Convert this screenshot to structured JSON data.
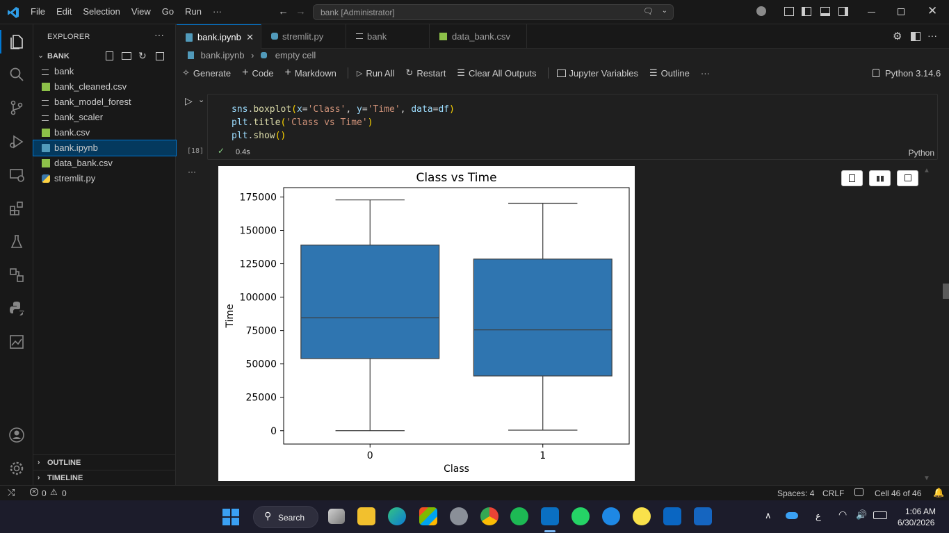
{
  "titlebar": {
    "menu": [
      "File",
      "Edit",
      "Selection",
      "View",
      "Go",
      "Run",
      "···"
    ],
    "search": "bank [Administrator]"
  },
  "sidebar": {
    "title": "EXPLORER",
    "folder": "BANK",
    "files": [
      {
        "name": "bank",
        "icon": "lines-icon"
      },
      {
        "name": "bank_cleaned.csv",
        "icon": "csv-icon"
      },
      {
        "name": "bank_model_forest",
        "icon": "lines-icon"
      },
      {
        "name": "bank_scaler",
        "icon": "lines-icon"
      },
      {
        "name": "bank.csv",
        "icon": "csv-icon"
      },
      {
        "name": "bank.ipynb",
        "icon": "notebook-icon"
      },
      {
        "name": "data_bank.csv",
        "icon": "csv-icon"
      },
      {
        "name": "stremlit.py",
        "icon": "python-icon"
      }
    ],
    "outline": "OUTLINE",
    "timeline": "TIMELINE"
  },
  "tabs": [
    "bank.ipynb",
    "stremlit.py",
    "bank",
    "data_bank.csv"
  ],
  "breadcrumb": {
    "file": "bank.ipynb",
    "cell": "empty cell"
  },
  "toolbar": {
    "generate": "Generate",
    "code": "Code",
    "markdown": "Markdown",
    "run_all": "Run All",
    "restart": "Restart",
    "clear": "Clear All Outputs",
    "variables": "Jupyter Variables",
    "outline": "Outline",
    "more": "···",
    "kernel": "Python 3.14.6"
  },
  "cell": {
    "lines": [
      "sns.boxplot(x='Class', y='Time', data=df)",
      "plt.title('Class vs Time')",
      "plt.show()"
    ],
    "exec_count": "[18]",
    "duration": "0.4s",
    "language": "Python",
    "output_more": "···"
  },
  "chart_data": {
    "type": "boxplot",
    "title": "Class vs Time",
    "xlabel": "Class",
    "ylabel": "Time",
    "categories": [
      "0",
      "1"
    ],
    "ylim": [
      -10000,
      182000
    ],
    "yticks": [
      0,
      25000,
      50000,
      75000,
      100000,
      125000,
      150000,
      175000
    ],
    "boxes": [
      {
        "category": "0",
        "min": 0,
        "q1": 54000,
        "median": 84500,
        "q3": 139000,
        "max": 172800
      },
      {
        "category": "1",
        "min": 400,
        "q1": 41000,
        "median": 75500,
        "q3": 128500,
        "max": 170300
      }
    ],
    "color": "#2f75b0"
  },
  "status": {
    "errors": "0",
    "warnings": "0",
    "spaces": "Spaces: 4",
    "eol": "CRLF",
    "cell_pos": "Cell 46 of 46"
  },
  "taskbar": {
    "search": "Search",
    "time": "1:06 AM",
    "date": "6/30/2026",
    "lang": "ع"
  }
}
